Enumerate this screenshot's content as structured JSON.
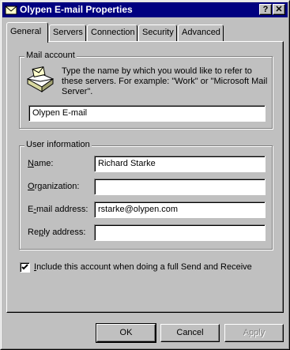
{
  "window": {
    "title": "Olypen E-mail Properties",
    "help_label": "?",
    "close_label": "✕"
  },
  "tabs": [
    {
      "label": "General",
      "active": true
    },
    {
      "label": "Servers",
      "active": false
    },
    {
      "label": "Connection",
      "active": false
    },
    {
      "label": "Security",
      "active": false
    },
    {
      "label": "Advanced",
      "active": false
    }
  ],
  "mail_account": {
    "legend": "Mail account",
    "description": "Type the name by which you would like to refer to these servers.  For example: \"Work\" or \"Microsoft Mail Server\".",
    "account_name": "Olypen E-mail"
  },
  "user_info": {
    "legend": "User information",
    "name_label": "Name:",
    "name_value": "Richard Starke",
    "org_label": "Organization:",
    "org_value": "",
    "email_label": "E-mail address:",
    "email_value": "rstarke@olypen.com",
    "reply_label": "Reply address:",
    "reply_value": ""
  },
  "include": {
    "label": "Include this account when doing a full Send and Receive",
    "checked": true
  },
  "buttons": {
    "ok": "OK",
    "cancel": "Cancel",
    "apply": "Apply"
  }
}
